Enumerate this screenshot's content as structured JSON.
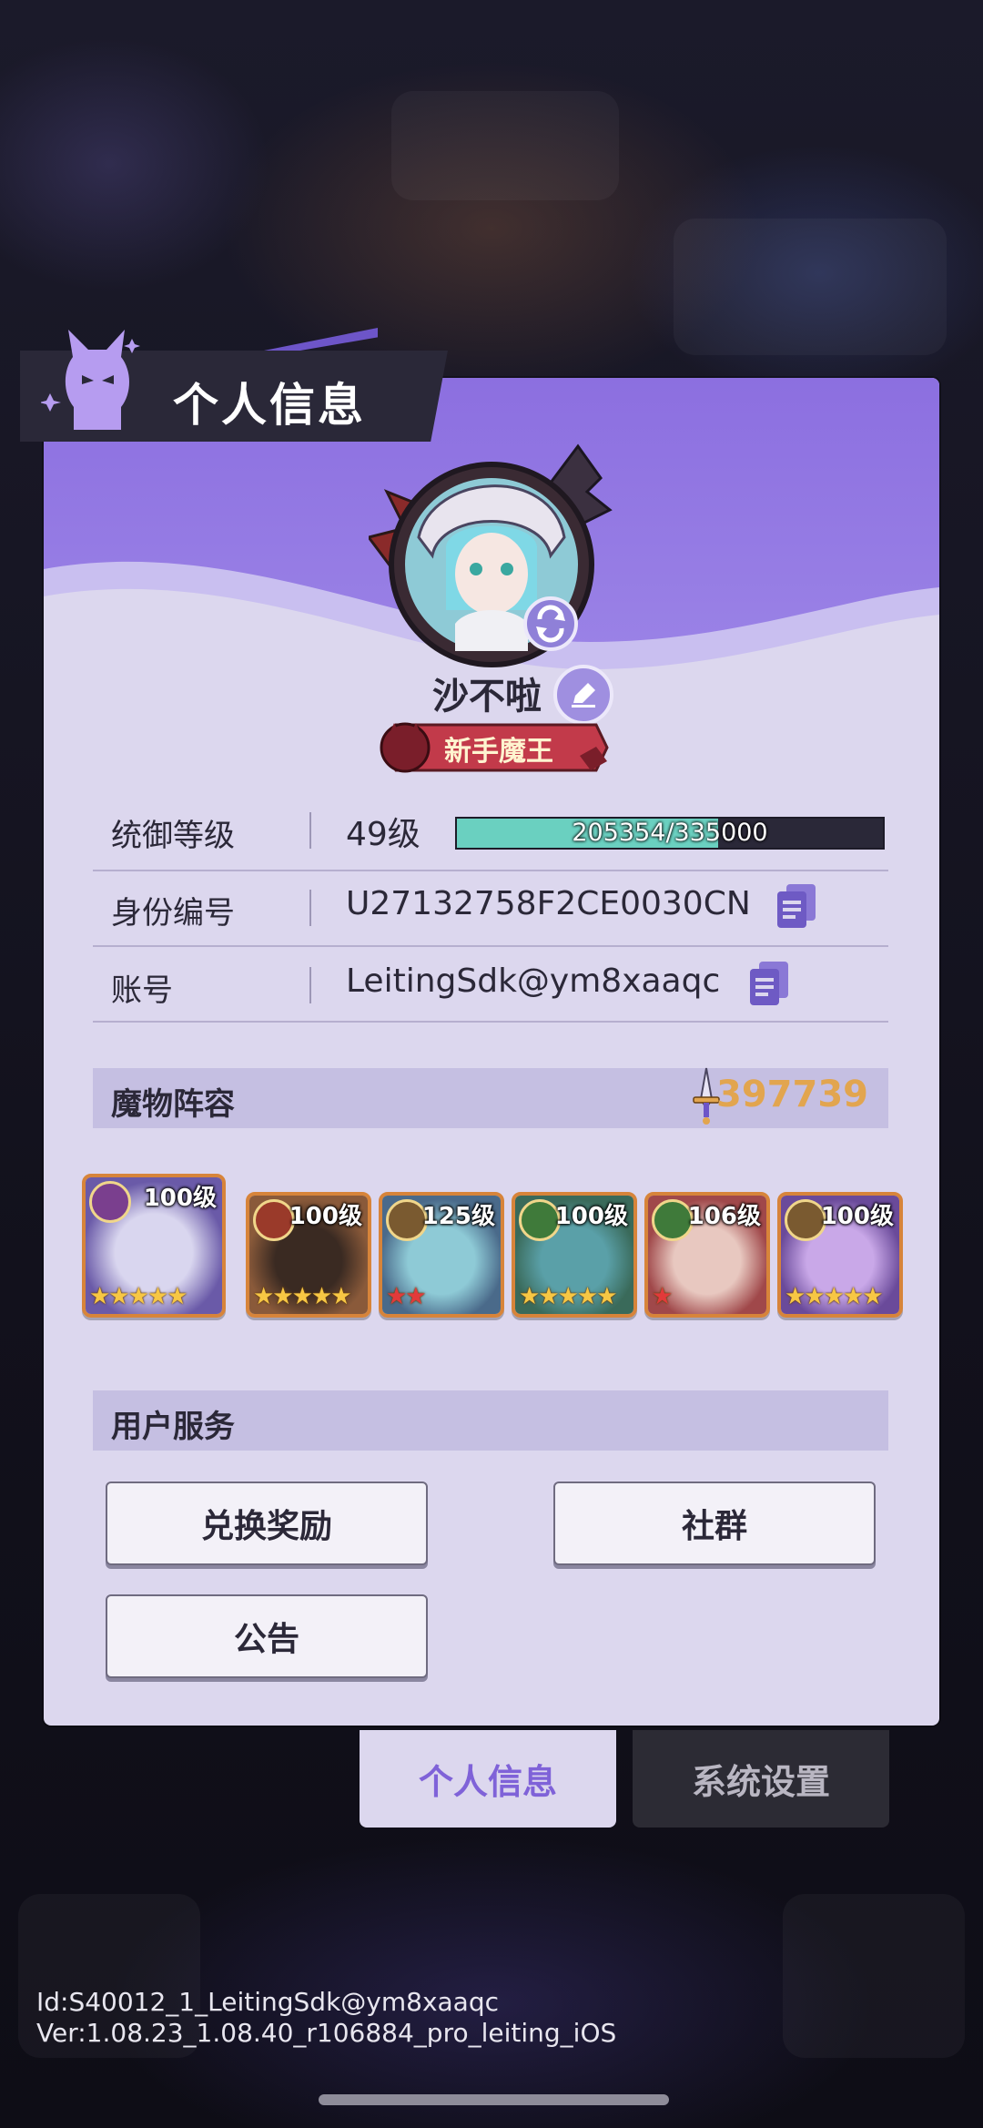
{
  "title": "个人信息",
  "player": {
    "name": "沙不啦",
    "rank_title": "新手魔王"
  },
  "info": {
    "level_label": "统御等级",
    "level_value": "49级",
    "exp_text": "205354/335000",
    "exp_fraction": 0.613,
    "id_label": "身份编号",
    "id_value": "U27132758F2CE0030CN",
    "account_label": "账号",
    "account_value": "LeitingSdk@ym8xaaqc"
  },
  "lineup": {
    "title": "魔物阵容",
    "power": "397739",
    "heroes": [
      {
        "level": "100级",
        "stars": 5,
        "red": false,
        "frame": "#d7843a",
        "elem": "#7a3f8e"
      },
      {
        "level": "100级",
        "stars": 5,
        "red": false,
        "frame": "#d7843a",
        "elem": "#9a3a2a"
      },
      {
        "level": "125级",
        "stars": 2,
        "red": true,
        "frame": "#d7843a",
        "elem": "#7a5a30"
      },
      {
        "level": "100级",
        "stars": 5,
        "red": false,
        "frame": "#d7843a",
        "elem": "#3f7a3a"
      },
      {
        "level": "106级",
        "stars": 1,
        "red": true,
        "frame": "#d7843a",
        "elem": "#3f7a3a"
      },
      {
        "level": "100级",
        "stars": 5,
        "red": false,
        "frame": "#d7843a",
        "elem": "#7a5a30"
      }
    ]
  },
  "services": {
    "title": "用户服务",
    "redeem": "兑换奖励",
    "community": "社群",
    "notice": "公告"
  },
  "tabs": {
    "profile": "个人信息",
    "settings": "系统设置"
  },
  "footer": {
    "id_line": "Id:S40012_1_LeitingSdk@ym8xaaqc",
    "ver_line": "Ver:1.08.23_1.08.40_r106884_pro_leiting_iOS"
  },
  "colors": {
    "accent": "#8c6fe0",
    "power": "#e2a54f",
    "exp_fill": "#6ad0c0"
  }
}
